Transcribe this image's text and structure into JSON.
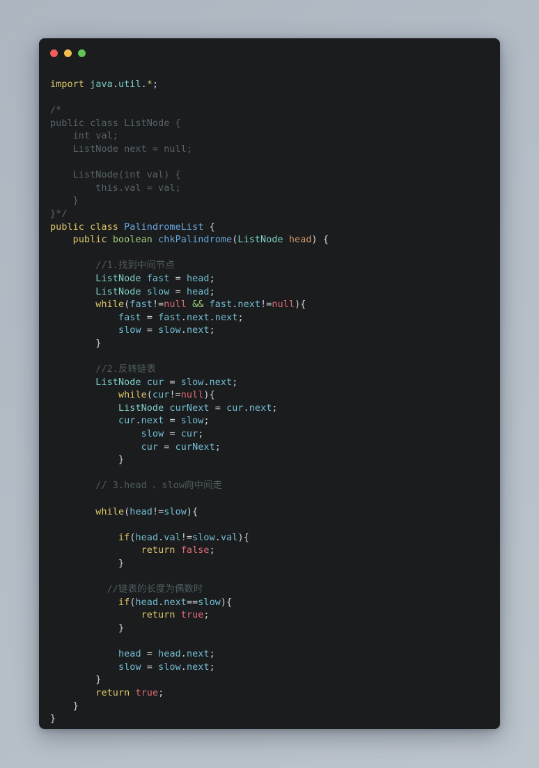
{
  "window": {
    "background_color": "#1a1c1e",
    "page_background_color": "#b3bcc6",
    "controls": [
      {
        "name": "close",
        "color": "#ef5f56"
      },
      {
        "name": "minimize",
        "color": "#f0bf4c"
      },
      {
        "name": "maximize",
        "color": "#61c454"
      }
    ]
  },
  "theme": {
    "keyword": "#dfc76a",
    "type": "#7fd0c8",
    "primitive": "#9fd07a",
    "function": "#69a8de",
    "variable": "#74bfd4",
    "parameter": "#d49a6a",
    "literal": "#e06c75",
    "operator": "#9fd07a",
    "punctuation": "#cfd3d6",
    "comment": "#4f5b5e"
  },
  "code": {
    "language": "Java",
    "lines": [
      "import java.util.*;",
      "",
      "/*",
      "public class ListNode {",
      "    int val;",
      "    ListNode next = null;",
      "",
      "    ListNode(int val) {",
      "        this.val = val;",
      "    }",
      "}*/",
      "public class PalindromeList {",
      "    public boolean chkPalindrome(ListNode head) {",
      "",
      "        //1.找到中间节点",
      "        ListNode fast = head;",
      "        ListNode slow = head;",
      "        while(fast!=null && fast.next!=null){",
      "            fast = fast.next.next;",
      "            slow = slow.next;",
      "        }",
      "",
      "        //2.反转链表",
      "        ListNode cur = slow.next;",
      "            while(cur!=null){",
      "            ListNode curNext = cur.next;",
      "            cur.next = slow;",
      "                slow = cur;",
      "                cur = curNext;",
      "            }",
      "",
      "        // 3.head 、slow向中间走",
      "",
      "        while(head!=slow){",
      "",
      "            if(head.val!=slow.val){",
      "                return false;",
      "            }",
      "",
      "          //链表的长度为偶数时",
      "            if(head.next==slow){",
      "                return true;",
      "            }",
      "",
      "            head = head.next;",
      "            slow = slow.next;",
      "        }",
      "        return true;",
      "    }",
      "}"
    ]
  }
}
